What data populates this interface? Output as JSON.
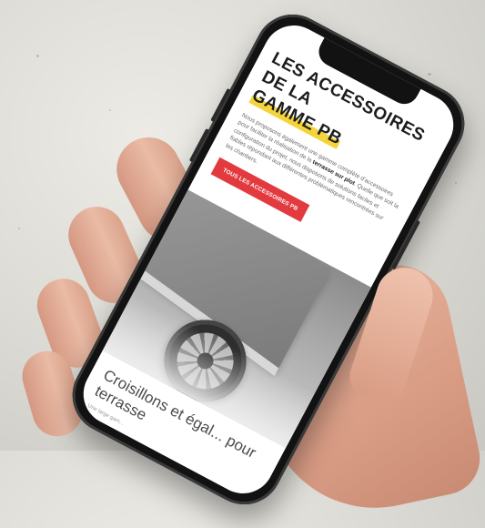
{
  "screen": {
    "title_line1": "LES ACCESSOIRES DE LA",
    "title_line2": "GAMME PB",
    "intro_before": "Nous proposons également une gamme complète d'accessoires pour faciliter la réalisation de la ",
    "intro_bold1": "terrasse sur plot",
    "intro_after": ". Quelle que soit la configuration du projet, nous disposons de solutions faciles et fiables répondant aux différentes problématiques rencontrées sur les chantiers.",
    "cta_label": "TOUS LES ACCESSOIRES PB",
    "section_title": "Croisillons et égal... pour terrasse",
    "section_sub": "Une large gam..."
  },
  "colors": {
    "accent": "#e23a3e",
    "highlight": "#f4d43a"
  }
}
